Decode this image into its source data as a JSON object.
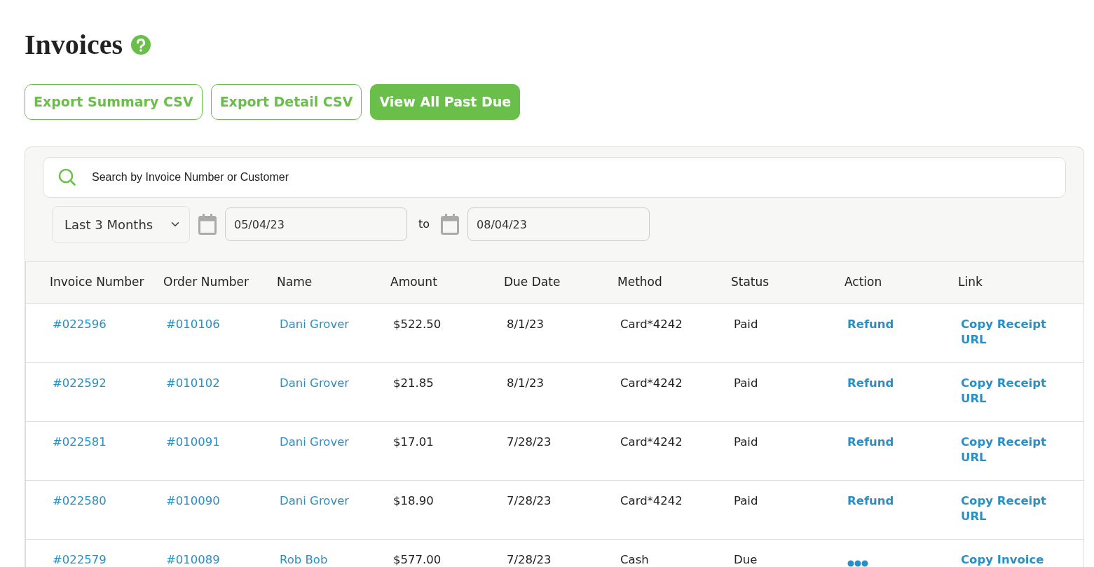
{
  "title": "Invoices",
  "buttons": [
    {
      "label": "Export Summary CSV",
      "kind": "outline"
    },
    {
      "label": "Export Detail CSV",
      "kind": "outline"
    },
    {
      "label": "View All Past Due",
      "kind": "solid"
    }
  ],
  "search": {
    "placeholder": "Search by Invoice Number or Customer"
  },
  "filters": {
    "range": "Last 3 Months",
    "from": "05/04/23",
    "separator": "to",
    "to": "08/04/23"
  },
  "table": {
    "columns": [
      "Invoice Number",
      "Order Number",
      "Name",
      "Amount",
      "Due Date",
      "Method",
      "Status",
      "Action",
      "Link"
    ],
    "rows": [
      {
        "invoice": "#022596",
        "order": "#010106",
        "name": "Dani Grover",
        "amount": "$522.50",
        "due": "8/1/23",
        "method": "Card*4242",
        "status": "Paid",
        "action": {
          "kind": "link",
          "label": "Refund"
        },
        "link": "Copy Receipt URL"
      },
      {
        "invoice": "#022592",
        "order": "#010102",
        "name": "Dani Grover",
        "amount": "$21.85",
        "due": "8/1/23",
        "method": "Card*4242",
        "status": "Paid",
        "action": {
          "kind": "link",
          "label": "Refund"
        },
        "link": "Copy Receipt URL"
      },
      {
        "invoice": "#022581",
        "order": "#010091",
        "name": "Dani Grover",
        "amount": "$17.01",
        "due": "7/28/23",
        "method": "Card*4242",
        "status": "Paid",
        "action": {
          "kind": "link",
          "label": "Refund"
        },
        "link": "Copy Receipt URL"
      },
      {
        "invoice": "#022580",
        "order": "#010090",
        "name": "Dani Grover",
        "amount": "$18.90",
        "due": "7/28/23",
        "method": "Card*4242",
        "status": "Paid",
        "action": {
          "kind": "link",
          "label": "Refund"
        },
        "link": "Copy Receipt URL"
      },
      {
        "invoice": "#022579",
        "order": "#010089",
        "name": "Rob Bob",
        "amount": "$577.00",
        "due": "7/28/23",
        "method": "Cash",
        "status": "Due",
        "action": {
          "kind": "more"
        },
        "link": "Copy Invoice"
      }
    ]
  }
}
